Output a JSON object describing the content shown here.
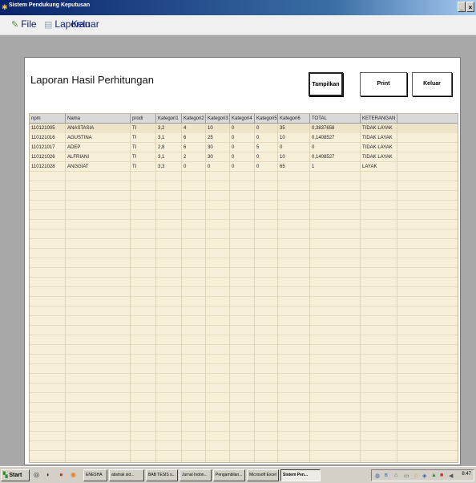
{
  "window": {
    "title": "Sistem Pendukung Keputusan",
    "controls": [
      "_",
      "×"
    ]
  },
  "menu": {
    "file": "File",
    "laporan": "Laporan",
    "keluar": "Keluar"
  },
  "report": {
    "title": "Laporan Hasil Perhitungan",
    "buttons": {
      "tampilkan": "Tampilkan",
      "print": "Print",
      "keluar": "Keluar"
    },
    "columns": [
      "npm",
      "Nama",
      "prodi",
      "Kategori1",
      "Kategori2",
      "Kategori3",
      "Kategori4",
      "Kategori5",
      "Kategori6",
      "TOTAL",
      "KETERANGAN"
    ],
    "rows": [
      [
        "110121005",
        "ANASTASIA",
        "TI",
        "3,2",
        "4",
        "10",
        "0",
        "0",
        "35",
        "0,3837658",
        "TIDAK LAYAK"
      ],
      [
        "110121016",
        "AGUSTINA",
        "TI",
        "3,1",
        "6",
        "25",
        "0",
        "0",
        "10",
        "0,1408527",
        "TIDAK LAYAK"
      ],
      [
        "110121017",
        "ADEP",
        "TI",
        "2,8",
        "6",
        "30",
        "0",
        "5",
        "0",
        "0",
        "TIDAK LAYAK"
      ],
      [
        "110121026",
        "ALFRIANI",
        "TI",
        "3,1",
        "2",
        "30",
        "0",
        "0",
        "10",
        "0,1408527",
        "TIDAK LAYAK"
      ],
      [
        "110121028",
        "ANGGIAT",
        "TI",
        "3,3",
        "0",
        "0",
        "0",
        "0",
        "65",
        "1",
        "LAYAK"
      ]
    ]
  },
  "taskbar": {
    "start": "Start",
    "tasks": [
      {
        "label": "ENESHA",
        "active": false
      },
      {
        "label": "abstrak sid...",
        "active": false
      },
      {
        "label": "BAB TESIS s...",
        "active": false
      },
      {
        "label": "Jurnal Indon...",
        "active": false
      },
      {
        "label": "Pengambilan...",
        "active": false
      },
      {
        "label": "Microsoft Excel",
        "active": false
      },
      {
        "label": "Sistem Pen...",
        "active": true
      }
    ],
    "clock": "8:47"
  }
}
